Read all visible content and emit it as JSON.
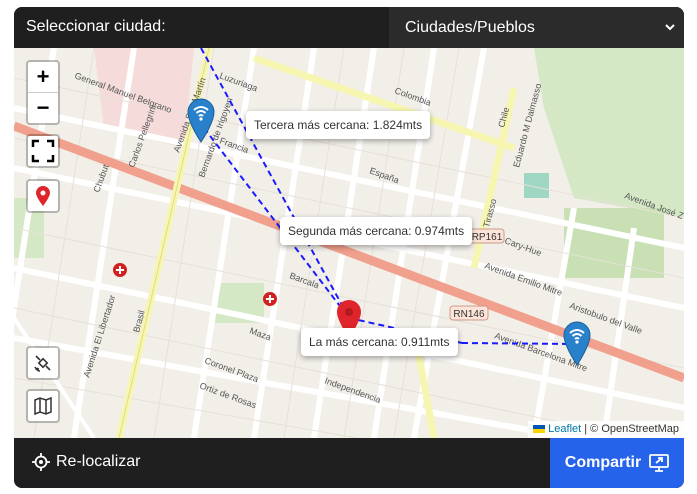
{
  "header": {
    "label": "Seleccionar ciudad:",
    "select_value": "Ciudades/Pueblos"
  },
  "map": {
    "popups": {
      "third": "Tercera más cercana: 1.824mts",
      "second": "Segunda más cercana: 0.974mts",
      "first": "La más cercana: 0.911mts"
    },
    "route_badges": {
      "rp161": "RP161",
      "rn146": "RN146"
    },
    "streets": {
      "general_manuel_belgrano": "General Manuel Belgrano",
      "avenida_san_martin": "Avenida San Martín",
      "avenida_el_libertador": "Avenida El Libertador",
      "avenida_barcelona_mitre": "Avenida Barcelona Mitre",
      "avenida_emilio_mitre": "Avenida Emilio Mitre",
      "avenida_jose": "Avenida José Z",
      "tirasso": "Tirasso",
      "barcala": "Barcala",
      "brasil": "Brasil",
      "maza": "Maza",
      "cary_hue": "Cary-Hue",
      "independencia": "Independencia",
      "espana": "España",
      "eduardo_m_dalmasso": "Eduardo M Dalmasso",
      "aristobulo_del_valle": "Aristobulo del Valle",
      "colombia": "Colombia",
      "chile": "Chile",
      "luzuriaga": "Luzuriaga",
      "francia": "Francia",
      "bernardo_de_irigoyen": "Bernardo de Irigoyen",
      "carlos_pellegrini": "Carlos Pellegrini",
      "coronel_plaza": "Coronel Plaza",
      "ortiz_de_rosas": "Ortiz de Rosas",
      "chubut": "Chubut"
    },
    "attribution": {
      "leaflet": "Leaflet",
      "separator": "|",
      "osm": "© OpenStreetMap"
    }
  },
  "controls": {
    "zoom_in": "+",
    "zoom_out": "−"
  },
  "footer": {
    "relocalize": "Re-localizar",
    "share": "Compartir"
  },
  "colors": {
    "accent": "#2563eb",
    "marker_blue": "#2a81cb",
    "marker_red": "#e0242b",
    "route_line": "#1a1aff"
  }
}
